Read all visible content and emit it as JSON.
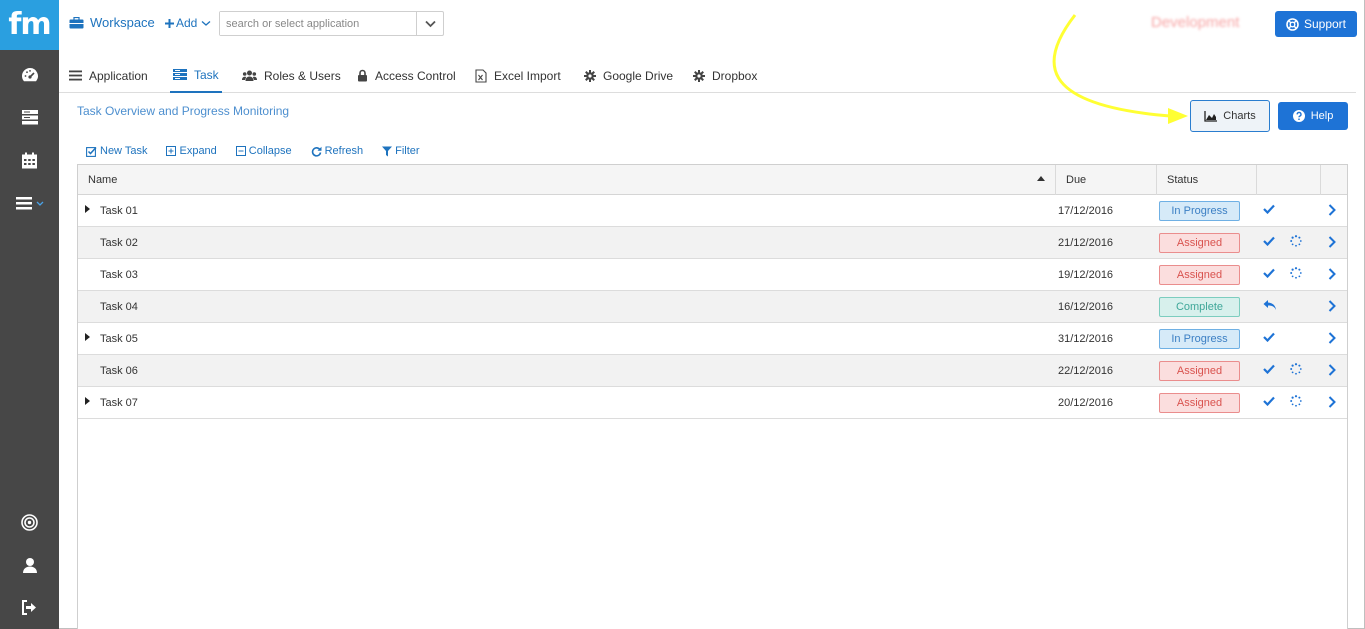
{
  "app": {
    "logo": "fm",
    "environment": "Development"
  },
  "topbar": {
    "workspace_label": "Workspace",
    "add_label": "Add",
    "search_placeholder": "search or select application",
    "support_label": "Support"
  },
  "sidebar": {
    "items": [
      {
        "icon": "dashboard-icon"
      },
      {
        "icon": "database-icon"
      },
      {
        "icon": "calendar-icon"
      },
      {
        "icon": "menu-icon"
      },
      {
        "icon": "target-icon"
      },
      {
        "icon": "user-icon"
      },
      {
        "icon": "logout-icon"
      }
    ]
  },
  "tabs": [
    {
      "label": "Application",
      "icon": "list-icon"
    },
    {
      "label": "Task",
      "icon": "tasks-icon",
      "active": true
    },
    {
      "label": "Roles & Users",
      "icon": "users-icon"
    },
    {
      "label": "Access Control",
      "icon": "lock-icon"
    },
    {
      "label": "Excel Import",
      "icon": "excel-file-icon"
    },
    {
      "label": "Google Drive",
      "icon": "gear-icon"
    },
    {
      "label": "Dropbox",
      "icon": "gear-icon"
    }
  ],
  "page": {
    "title": "Task Overview and Progress Monitoring",
    "charts_label": "Charts",
    "help_label": "Help"
  },
  "toolbar": {
    "new_task": "New Task",
    "expand": "Expand",
    "collapse": "Collapse",
    "refresh": "Refresh",
    "filter": "Filter"
  },
  "grid": {
    "columns": {
      "name": "Name",
      "due": "Due",
      "status": "Status"
    },
    "rows": [
      {
        "name": "Task 01",
        "due": "17/12/2016",
        "status": "In Progress",
        "status_type": "blue",
        "has_children": true,
        "actions": [
          "check"
        ]
      },
      {
        "name": "Task 02",
        "due": "21/12/2016",
        "status": "Assigned",
        "status_type": "red",
        "has_children": false,
        "actions": [
          "check",
          "spinner"
        ]
      },
      {
        "name": "Task 03",
        "due": "19/12/2016",
        "status": "Assigned",
        "status_type": "red",
        "has_children": false,
        "actions": [
          "check",
          "spinner"
        ]
      },
      {
        "name": "Task 04",
        "due": "16/12/2016",
        "status": "Complete",
        "status_type": "teal",
        "has_children": false,
        "actions": [
          "reply"
        ]
      },
      {
        "name": "Task 05",
        "due": "31/12/2016",
        "status": "In Progress",
        "status_type": "blue",
        "has_children": true,
        "actions": [
          "check"
        ]
      },
      {
        "name": "Task 06",
        "due": "22/12/2016",
        "status": "Assigned",
        "status_type": "red",
        "has_children": false,
        "actions": [
          "check",
          "spinner"
        ]
      },
      {
        "name": "Task 07",
        "due": "20/12/2016",
        "status": "Assigned",
        "status_type": "red",
        "has_children": true,
        "actions": [
          "check",
          "spinner"
        ]
      }
    ]
  },
  "colors": {
    "brand": "#2a9fe0",
    "sidebar": "#474747",
    "primary": "#1e73d6",
    "link": "#1e73be",
    "annotation_arrow": "#ffff33"
  }
}
